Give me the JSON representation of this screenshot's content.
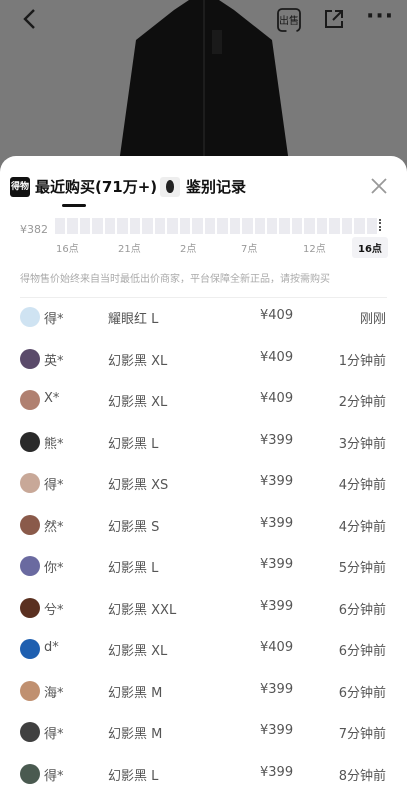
{
  "topbar": {
    "back_icon": "chevron-left-icon",
    "sell_label": "出售",
    "share_icon": "share-external-icon",
    "more_icon": "more-dots-icon",
    "more_glyph": "···"
  },
  "sheet": {
    "tabs": [
      {
        "label": "最近购买(71万+)",
        "logo": "得物",
        "active": true
      },
      {
        "label": "鉴别记录",
        "active": false
      }
    ],
    "close_icon": "close-x-icon"
  },
  "chart": {
    "y_label": "¥382",
    "ticks": [
      "16点",
      "21点",
      "2点",
      "7点",
      "12点",
      "16点"
    ]
  },
  "note": "得物售价始终来自当时最低出价商家，平台保障全新正品，请按需购买",
  "purchases": [
    {
      "name": "得*",
      "spec": "耀眼红 L",
      "price": "¥409",
      "time": "刚刚",
      "avatar_color": "#cfe3f2"
    },
    {
      "name": "英*",
      "spec": "幻影黑 XL",
      "price": "¥409",
      "time": "1分钟前",
      "avatar_color": "#5a4a6a"
    },
    {
      "name": "X*",
      "spec": "幻影黑 XL",
      "price": "¥409",
      "time": "2分钟前",
      "avatar_color": "#b08070"
    },
    {
      "name": "熊*",
      "spec": "幻影黑 L",
      "price": "¥399",
      "time": "3分钟前",
      "avatar_color": "#2a2a2a"
    },
    {
      "name": "得*",
      "spec": "幻影黑 XS",
      "price": "¥399",
      "time": "4分钟前",
      "avatar_color": "#c8a898"
    },
    {
      "name": "然*",
      "spec": "幻影黑 S",
      "price": "¥399",
      "time": "4分钟前",
      "avatar_color": "#8a5a4a"
    },
    {
      "name": "你*",
      "spec": "幻影黑 L",
      "price": "¥399",
      "time": "5分钟前",
      "avatar_color": "#6a6aa0"
    },
    {
      "name": "兮*",
      "spec": "幻影黑 XXL",
      "price": "¥399",
      "time": "6分钟前",
      "avatar_color": "#5a3020"
    },
    {
      "name": "d*",
      "spec": "幻影黑 XL",
      "price": "¥409",
      "time": "6分钟前",
      "avatar_color": "#1e5fb0"
    },
    {
      "name": "海*",
      "spec": "幻影黑 M",
      "price": "¥399",
      "time": "6分钟前",
      "avatar_color": "#c09070"
    },
    {
      "name": "得*",
      "spec": "幻影黑 M",
      "price": "¥399",
      "time": "7分钟前",
      "avatar_color": "#404040"
    },
    {
      "name": "得*",
      "spec": "幻影黑 L",
      "price": "¥399",
      "time": "8分钟前",
      "avatar_color": "#4a5a50"
    }
  ]
}
